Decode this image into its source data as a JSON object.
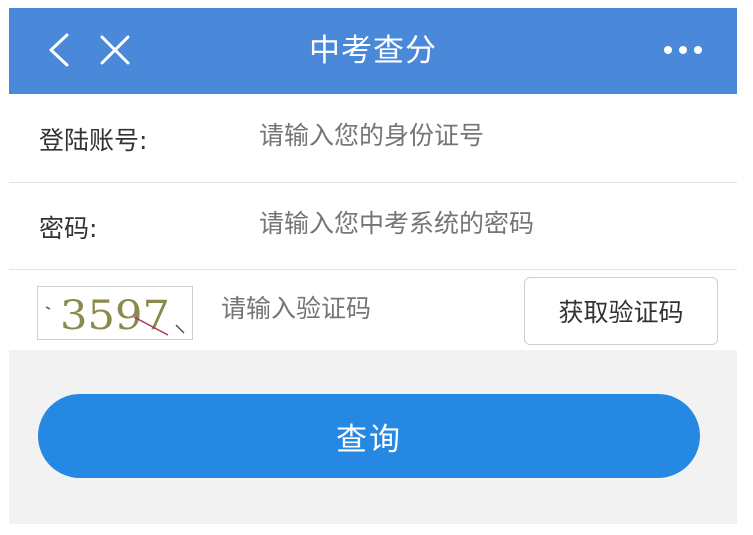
{
  "header": {
    "title": "中考查分",
    "back_icon": "back-arrow-icon",
    "close_icon": "close-icon",
    "more_icon": "more-icon"
  },
  "form": {
    "account_label": "登陆账号:",
    "account_placeholder": "请输入您的身份证号",
    "password_label": "密码:",
    "password_placeholder": "请输入您中考系统的密码",
    "captcha_image_text": "3597",
    "captcha_placeholder": "请输入验证码",
    "get_code_label": "获取验证码"
  },
  "actions": {
    "query_label": "查询"
  },
  "colors": {
    "header_bg": "#4a88d9",
    "button_bg": "#2588e2",
    "page_bg": "#f2f2f2"
  }
}
